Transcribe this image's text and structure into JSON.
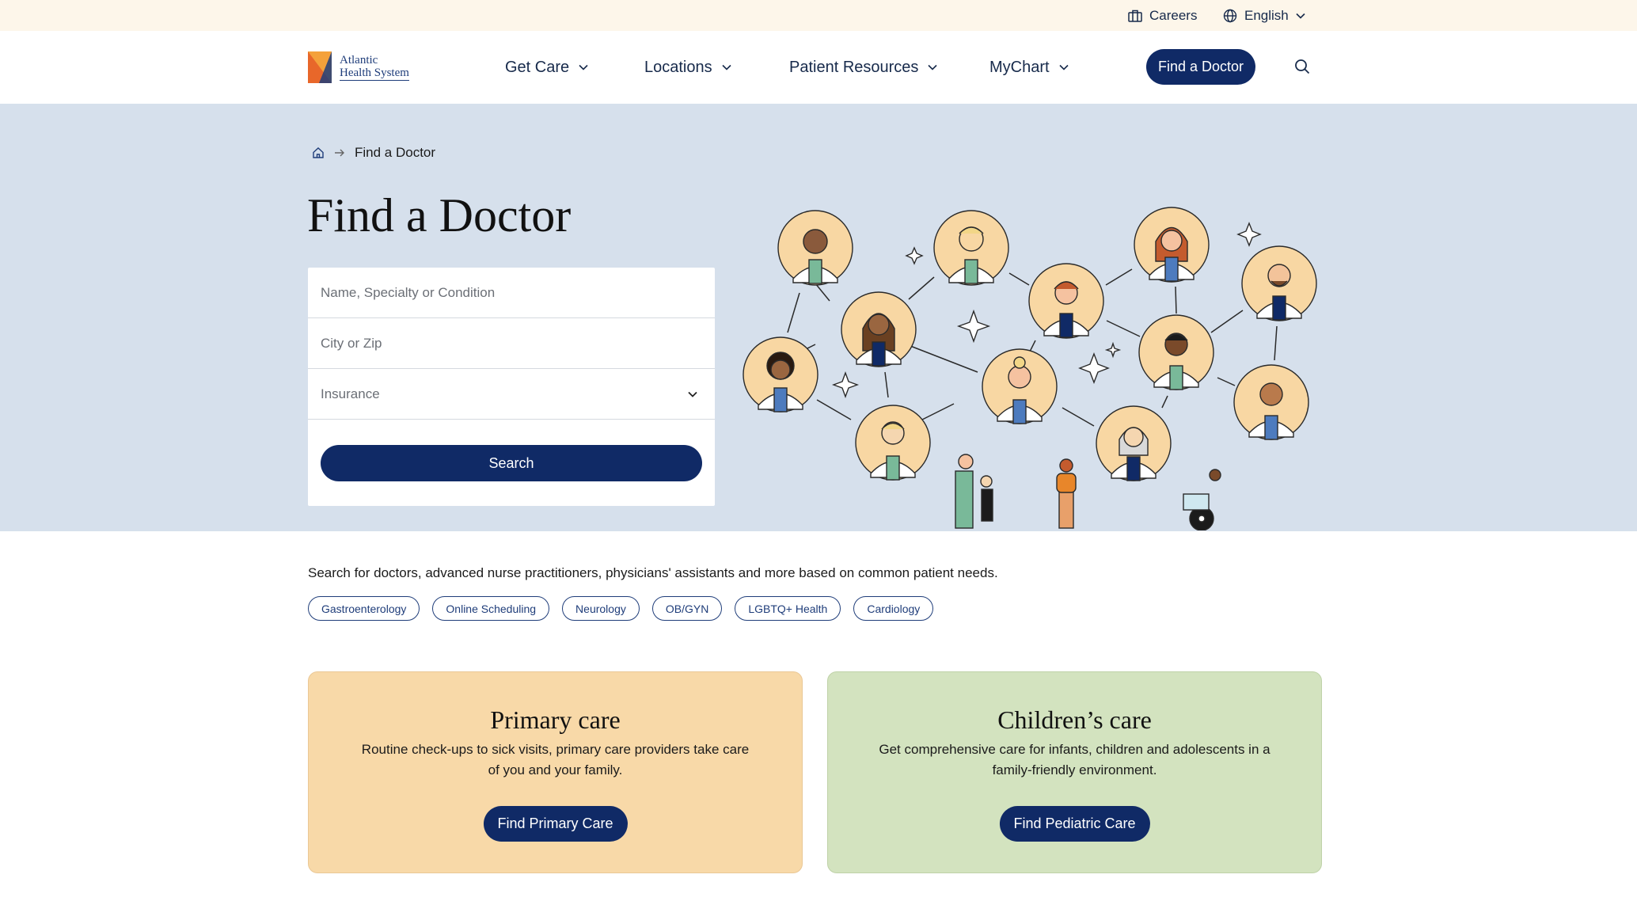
{
  "utility": {
    "careers": "Careers",
    "language": "English"
  },
  "header": {
    "logo_line1": "Atlantic",
    "logo_line2": "Health System",
    "nav": [
      {
        "label": "Get Care"
      },
      {
        "label": "Locations"
      },
      {
        "label": "Patient Resources"
      },
      {
        "label": "MyChart"
      }
    ],
    "cta": "Find a Doctor"
  },
  "breadcrumb": {
    "current": "Find a Doctor"
  },
  "hero": {
    "title": "Find a Doctor"
  },
  "search": {
    "name_placeholder": "Name, Specialty or Condition",
    "city_placeholder": "City or Zip",
    "insurance_label": "Insurance",
    "button": "Search"
  },
  "intro": "Search for doctors, advanced nurse practitioners, physicians' assistants and more based on common patient needs.",
  "chips": [
    "Gastroenterology",
    "Online Scheduling",
    "Neurology",
    "OB/GYN",
    "LGBTQ+ Health",
    "Cardiology"
  ],
  "cards": {
    "primary": {
      "title": "Primary care",
      "desc": "Routine check-ups to sick visits, primary care providers take care of you and your family.",
      "button": "Find Primary Care"
    },
    "children": {
      "title": "Children’s care",
      "desc": "Get comprehensive care for infants, children and adolescents in a family-friendly environment.",
      "button": "Find Pediatric Care"
    }
  },
  "colors": {
    "navy": "#102a66",
    "hero_bg": "#d6e0ec",
    "utility_bg": "#fdf6ea",
    "primary_card": "#f8d9a8",
    "children_card": "#d3e3bf"
  }
}
